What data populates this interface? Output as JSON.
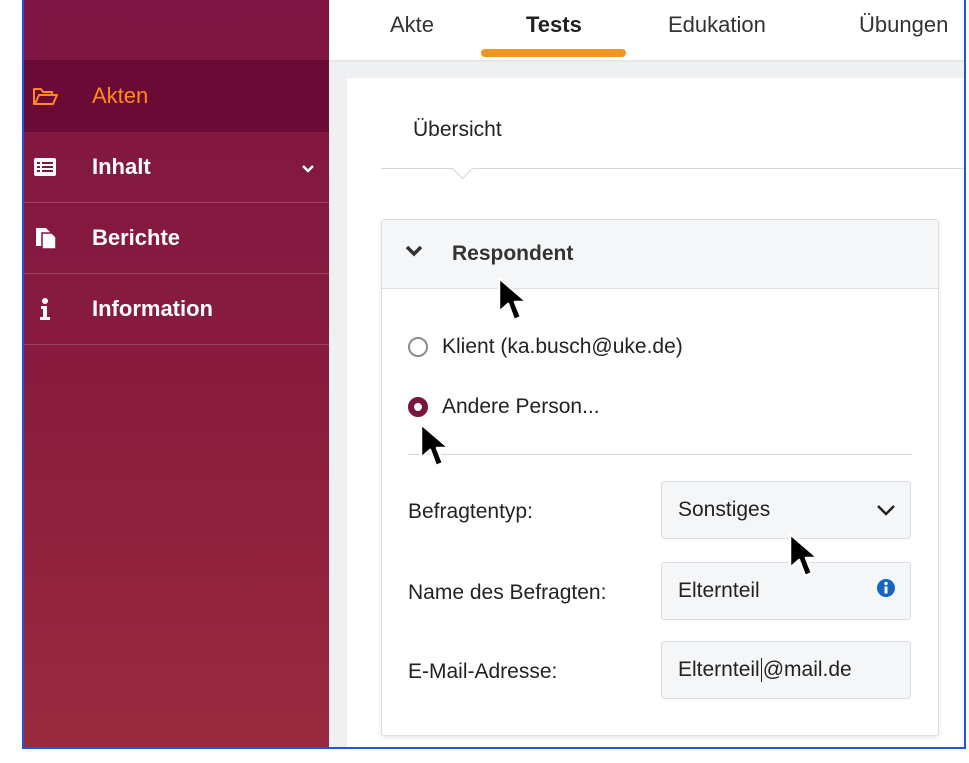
{
  "sidebar": {
    "items": [
      {
        "label": "Akten",
        "icon": "folder-open-icon",
        "active": true
      },
      {
        "label": "Inhalt",
        "icon": "list-icon",
        "has_chevron": true
      },
      {
        "label": "Berichte",
        "icon": "documents-icon"
      },
      {
        "label": "Information",
        "icon": "info-icon"
      }
    ]
  },
  "tabs": {
    "items": [
      {
        "label": "Akte"
      },
      {
        "label": "Tests",
        "active": true
      },
      {
        "label": "Edukation"
      },
      {
        "label": "Übungen"
      }
    ]
  },
  "subnav": {
    "label": "Übersicht"
  },
  "respondent": {
    "title": "Respondent",
    "options": [
      {
        "label": "Klient (ka.busch@uke.de)",
        "selected": false
      },
      {
        "label": "Andere Person...",
        "selected": true
      }
    ],
    "fields": {
      "type_label": "Befragtentyp:",
      "type_value": "Sonstiges",
      "name_label": "Name des Befragten:",
      "name_value": "Elternteil",
      "email_label": "E-Mail-Adresse:",
      "email_value_before_caret": "Elternteil",
      "email_value_after_caret": "@mail.de"
    }
  },
  "colors": {
    "sidebar": "#7e1542",
    "sidebar_active": "#6b0a35",
    "accent_orange": "#f0951f",
    "radio_selected": "#7a1540",
    "info_blue": "#1565c0"
  }
}
